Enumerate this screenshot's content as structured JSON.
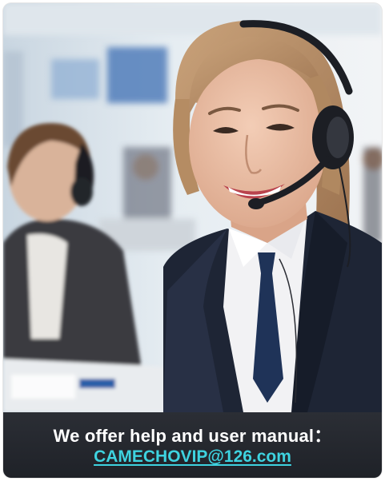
{
  "caption": {
    "headline": "We offer help and user manual：",
    "email": "CAMECHOVIP@126.com"
  },
  "photo": {
    "subject": "smiling customer service agent wearing headset",
    "background": "call center office with colleague wearing headset"
  },
  "colors": {
    "caption_background": "#24272e",
    "headline_text": "#ffffff",
    "email_text": "#3ed3e0",
    "suit": "#1e2535",
    "tie": "#1f3358"
  }
}
